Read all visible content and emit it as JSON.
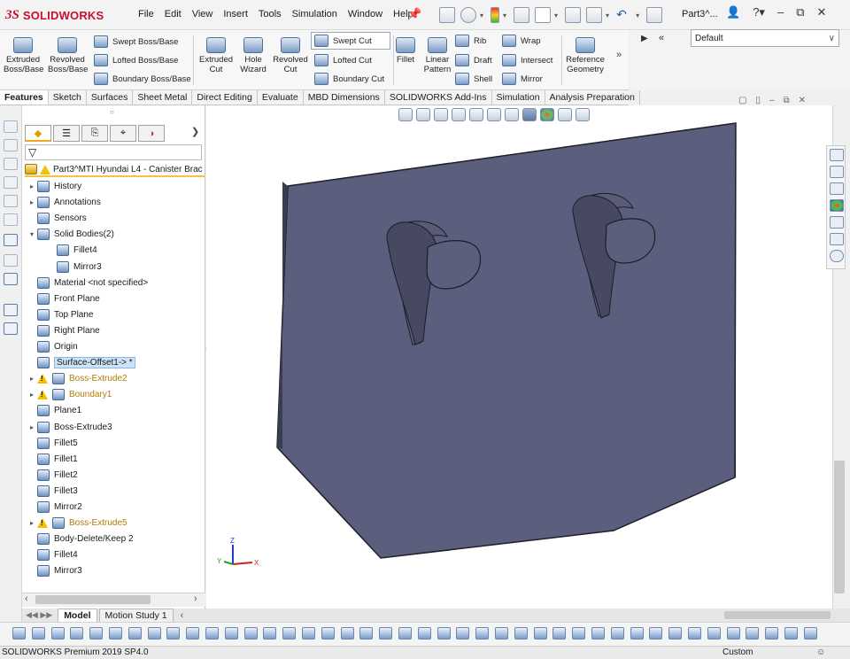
{
  "app": {
    "brand_ds": "3S",
    "brand_name": "SOLIDWORKS",
    "doc_title": "Part3^..."
  },
  "menu": [
    "File",
    "Edit",
    "View",
    "Insert",
    "Tools",
    "Simulation",
    "Window",
    "Help"
  ],
  "command_manager": {
    "big": [
      {
        "label": "Extruded\nBoss/Base",
        "icon": "extruded-boss-icon"
      },
      {
        "label": "Revolved\nBoss/Base",
        "icon": "revolved-boss-icon"
      },
      {
        "label": "Extruded\nCut",
        "icon": "extruded-cut-icon"
      },
      {
        "label": "Hole\nWizard",
        "icon": "hole-wizard-icon"
      },
      {
        "label": "Revolved\nCut",
        "icon": "revolved-cut-icon"
      },
      {
        "label": "Fillet",
        "icon": "fillet-icon"
      },
      {
        "label": "Linear\nPattern",
        "icon": "linear-pattern-icon"
      },
      {
        "label": "Reference\nGeometry",
        "icon": "reference-geometry-icon"
      }
    ],
    "small": {
      "swept_boss": "Swept Boss/Base",
      "lofted_boss": "Lofted Boss/Base",
      "boundary_boss": "Boundary Boss/Base",
      "swept_cut": "Swept Cut",
      "lofted_cut": "Lofted Cut",
      "boundary_cut": "Boundary Cut",
      "rib": "Rib",
      "draft": "Draft",
      "shell": "Shell",
      "wrap": "Wrap",
      "intersect": "Intersect",
      "mirror": "Mirror"
    },
    "configuration": "Default"
  },
  "tabs": [
    "Features",
    "Sketch",
    "Surfaces",
    "Sheet Metal",
    "Direct Editing",
    "Evaluate",
    "MBD Dimensions",
    "SOLIDWORKS Add-Ins",
    "Simulation",
    "Analysis Preparation"
  ],
  "feature_tree": {
    "root": "Part3^MTI Hyundai L4 - Canister Brac",
    "items": [
      {
        "label": "History",
        "expander": "▸",
        "icon": "history-icon"
      },
      {
        "label": "Annotations",
        "expander": "▸",
        "icon": "annotations-icon"
      },
      {
        "label": "Sensors",
        "expander": "",
        "icon": "sensors-icon"
      },
      {
        "label": "Solid Bodies(2)",
        "expander": "▾",
        "icon": "solid-bodies-icon"
      },
      {
        "label": "Fillet4",
        "expander": "",
        "icon": "body-icon",
        "indent": true
      },
      {
        "label": "Mirror3",
        "expander": "",
        "icon": "body-icon",
        "indent": true
      },
      {
        "label": "Material <not specified>",
        "expander": "",
        "icon": "material-icon"
      },
      {
        "label": "Front Plane",
        "expander": "",
        "icon": "plane-icon"
      },
      {
        "label": "Top Plane",
        "expander": "",
        "icon": "plane-icon"
      },
      {
        "label": "Right Plane",
        "expander": "",
        "icon": "plane-icon"
      },
      {
        "label": "Origin",
        "expander": "",
        "icon": "origin-icon"
      },
      {
        "label": "Surface-Offset1-> *",
        "expander": "",
        "icon": "surface-offset-icon",
        "selected": true
      },
      {
        "label": "Boss-Extrude2",
        "expander": "▸",
        "icon": "boss-extrude-icon",
        "warn": true
      },
      {
        "label": "Boundary1",
        "expander": "▸",
        "icon": "boundary-icon",
        "warn": true
      },
      {
        "label": "Plane1",
        "expander": "",
        "icon": "plane-icon"
      },
      {
        "label": "Boss-Extrude3",
        "expander": "▸",
        "icon": "boss-extrude-icon"
      },
      {
        "label": "Fillet5",
        "expander": "",
        "icon": "fillet-icon"
      },
      {
        "label": "Fillet1",
        "expander": "",
        "icon": "fillet-icon"
      },
      {
        "label": "Fillet2",
        "expander": "",
        "icon": "fillet-icon"
      },
      {
        "label": "Fillet3",
        "expander": "",
        "icon": "fillet-icon"
      },
      {
        "label": "Mirror2",
        "expander": "",
        "icon": "mirror-icon"
      },
      {
        "label": "Boss-Extrude5",
        "expander": "▸",
        "icon": "boss-extrude-icon",
        "warn": true
      },
      {
        "label": "Body-Delete/Keep 2",
        "expander": "",
        "icon": "body-delete-icon"
      },
      {
        "label": "Fillet4",
        "expander": "",
        "icon": "fillet-icon"
      },
      {
        "label": "Mirror3",
        "expander": "",
        "icon": "mirror-icon"
      }
    ]
  },
  "bottom_tabs": [
    "Model",
    "Motion Study 1"
  ],
  "status": {
    "version": "SOLIDWORKS Premium 2019 SP4.0",
    "units": "Custom"
  },
  "colors": {
    "part_face": "#5b5e7c",
    "part_edge": "#2a2b36",
    "brand": "#c8102e",
    "warning": "#f2c200"
  }
}
